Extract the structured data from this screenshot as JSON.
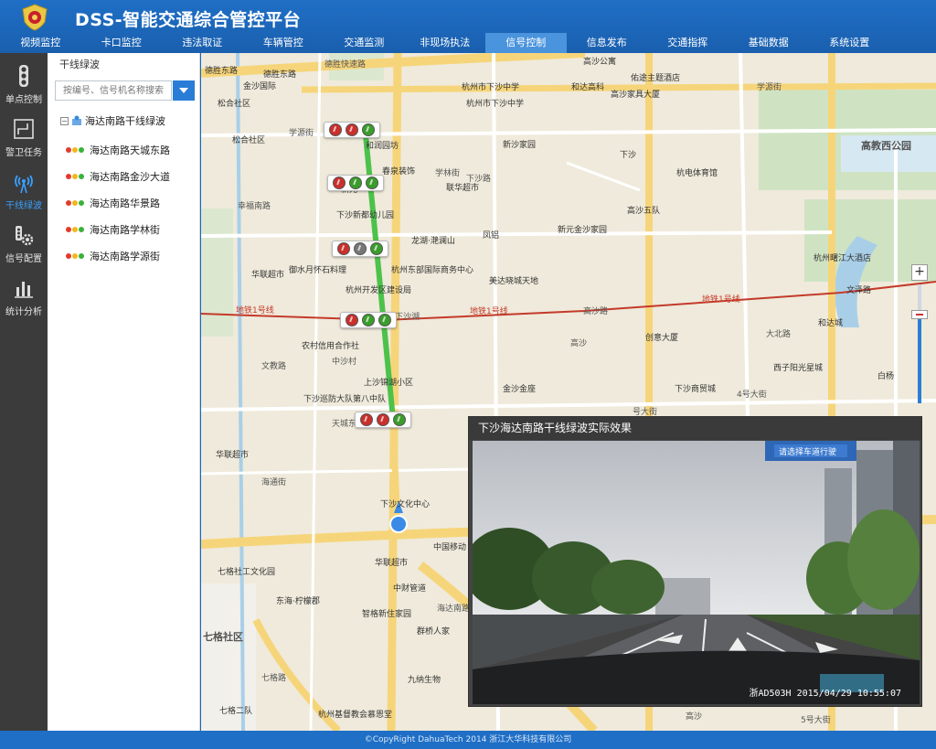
{
  "header": {
    "title": "DSS-智能交通综合管控平台",
    "nav": [
      "视频监控",
      "卡口监控",
      "违法取证",
      "车辆管控",
      "交通监测",
      "非现场执法",
      "信号控制",
      "信息发布",
      "交通指挥",
      "基础数据",
      "系统设置"
    ],
    "active_nav": "信号控制"
  },
  "sidebar": {
    "items": [
      {
        "label": "单点控制",
        "icon": "traffic-light-icon"
      },
      {
        "label": "警卫任务",
        "icon": "route-icon"
      },
      {
        "label": "干线绿波",
        "icon": "signal-wave-icon"
      },
      {
        "label": "信号配置",
        "icon": "config-icon"
      },
      {
        "label": "统计分析",
        "icon": "bar-chart-icon"
      }
    ],
    "active": "干线绿波"
  },
  "tree": {
    "title": "干线绿波",
    "search_placeholder": "按编号、信号机名称搜索",
    "root_label": "海达南路干线绿波",
    "items": [
      "海达南路天城东路",
      "海达南路金沙大道",
      "海达南路华景路",
      "海达南路学林街",
      "海达南路学源街"
    ]
  },
  "map": {
    "labels": [
      "德胜东路",
      "德胜东路",
      "德胜快速路",
      "杭州市下沙中学",
      "高沙公寓",
      "金沙国际",
      "佑途主题酒店",
      "松合社区",
      "学源街",
      "杭州市下沙中学",
      "和达高科",
      "高沙家具大厦",
      "松合社区",
      "学源街",
      "和润园坊",
      "新沙家园",
      "下沙",
      "高教西公园",
      "春泉装饰",
      "学林街",
      "杭电体育馆",
      "幸福南路",
      "下沙路",
      "新元",
      "联华超市",
      "高沙五队",
      "下沙新都幼儿园",
      "龙湖·滟澜山",
      "凤铝",
      "新元金沙家园",
      "杭州曙江大酒店",
      "华联超市",
      "御水月怀石料理",
      "杭州东部国际商务中心",
      "美达晓城天地",
      "杭州开发区建设局",
      "高沙路",
      "文泽路",
      "下沙湖",
      "和达城",
      "中沙村",
      "农村信用合作社",
      "创意大厦",
      "大北路",
      "高沙",
      "西子阳光星城",
      "白杨",
      "文教路",
      "上沙锦湖小区",
      "下沙巡防大队第八中队",
      "金沙金座",
      "下沙商贸城",
      "天城东路",
      "4号大街",
      "华联超市",
      "海通街",
      "下沙文化中心",
      "中国移动",
      "七格社区",
      "七格社工文化园",
      "东海·柠檬郡",
      "智格新住家园",
      "华联超市",
      "中财管道",
      "海达南路",
      "群桥人家",
      "七格路",
      "九纳生物",
      "七格二队",
      "杭州基督教会慕恩堂",
      "高沙",
      "号大街",
      "5号大街"
    ],
    "metro_label": "地铁1号线",
    "streets": [
      "学源街",
      "学林街",
      "文泽路",
      "天城东路",
      "下沙路",
      "学正街",
      "海通街",
      "4号大街",
      "2号大街",
      "幸福南路",
      "海达南路"
    ]
  },
  "signals": [
    {
      "lamps": [
        "red",
        "red",
        "green"
      ]
    },
    {
      "lamps": [
        "red",
        "green",
        "green"
      ]
    },
    {
      "lamps": [
        "red",
        "gray",
        "green"
      ]
    },
    {
      "lamps": [
        "red",
        "green",
        "green"
      ]
    },
    {
      "lamps": [
        "red",
        "red",
        "green"
      ]
    }
  ],
  "video": {
    "title": "下沙海达南路干线绿波实际效果",
    "stamp": "浙AD503H 2015/04/29 10:55:07",
    "sign_text": "请选择车道行驶"
  },
  "zoom": {
    "level": 0.75,
    "plus": "+",
    "minus": "−"
  },
  "footer": "©CopyRight DahuaTech 2014 浙江大华科技有限公司"
}
